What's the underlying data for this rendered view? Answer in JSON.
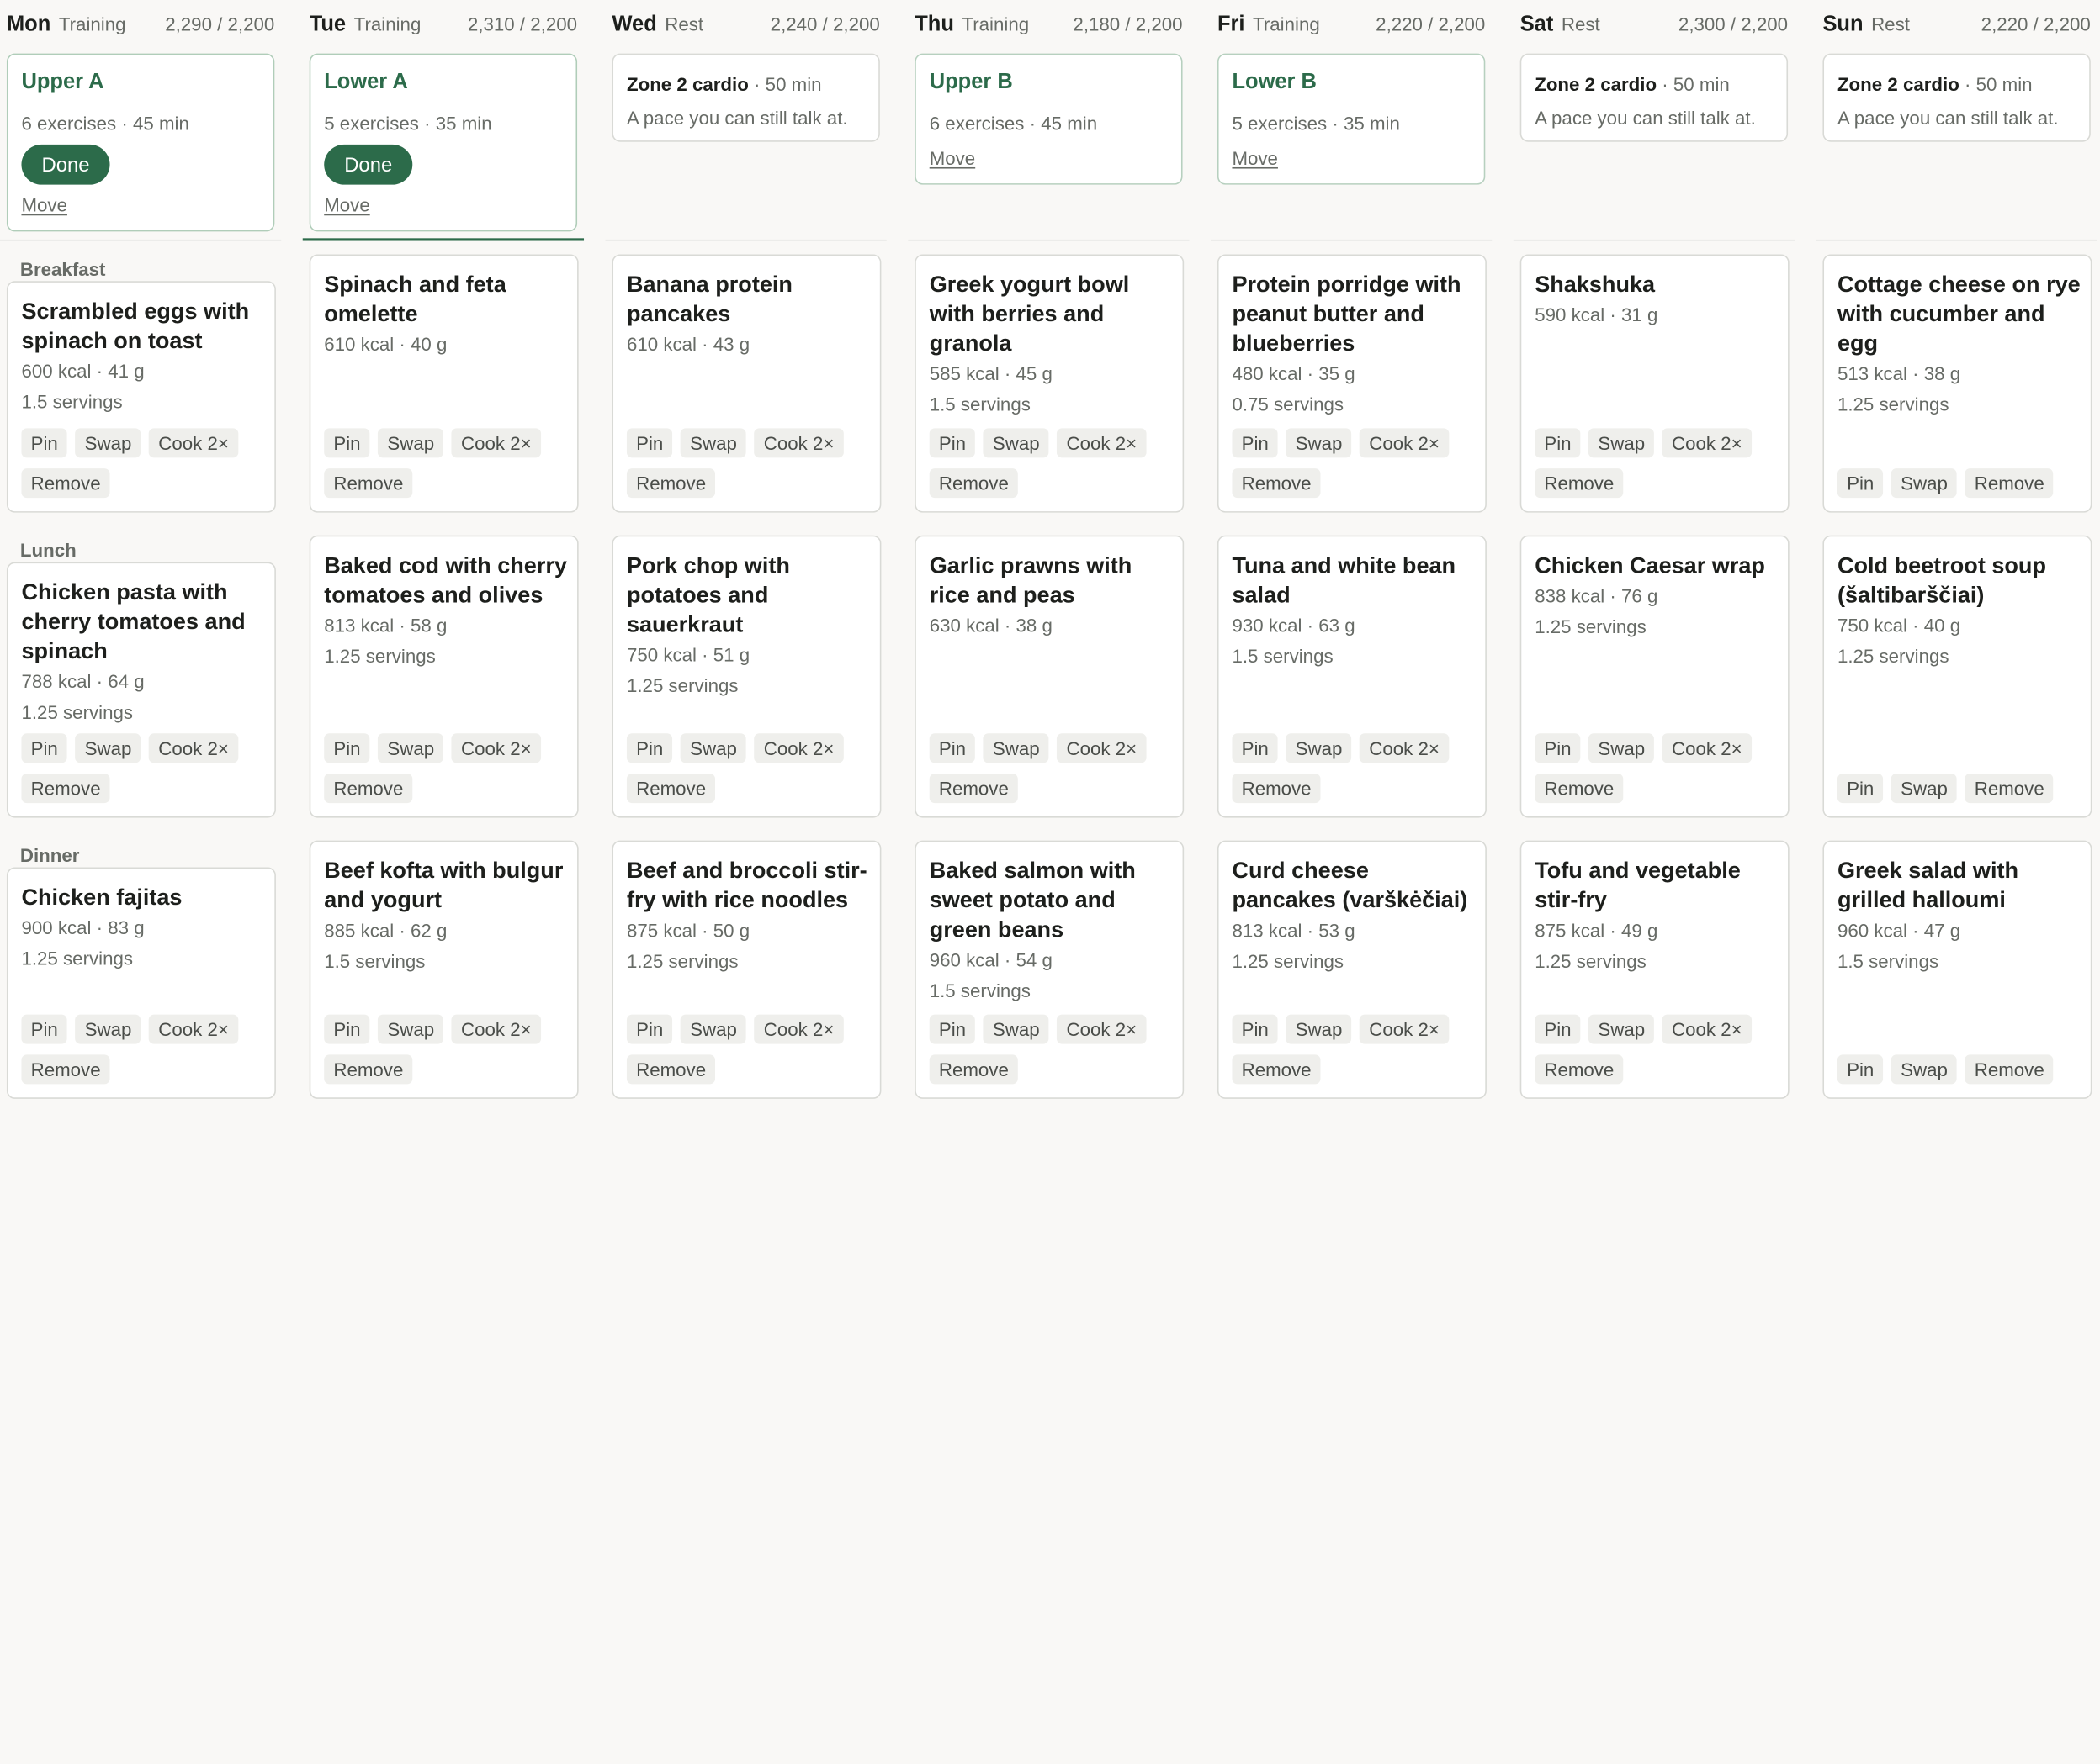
{
  "labels": {
    "done": "Done",
    "move": "Move",
    "breakfast": "Breakfast",
    "lunch": "Lunch",
    "dinner": "Dinner",
    "pin": "Pin",
    "swap": "Swap",
    "cook2x": "Cook 2×",
    "remove": "Remove"
  },
  "colors": {
    "accent": "#2c6b4a",
    "chip_bg": "#efefec",
    "muted": "#676b66"
  },
  "days": [
    {
      "name": "Mon",
      "type": "Training",
      "kcal": "2,290 / 2,200",
      "workout": {
        "kind": "training",
        "title": "Upper A",
        "meta": "6 exercises · 45 min",
        "done": true
      },
      "meals": [
        {
          "name": "Scrambled eggs with spinach on toast",
          "kcal": "600 kcal · 41 g",
          "servings": "1.5 servings"
        },
        {
          "name": "Chicken pasta with cherry tomatoes and spinach",
          "kcal": "788 kcal · 64 g",
          "servings": "1.25 servings"
        },
        {
          "name": "Chicken fajitas",
          "kcal": "900 kcal · 83 g",
          "servings": "1.25 servings"
        }
      ]
    },
    {
      "name": "Tue",
      "type": "Training",
      "kcal": "2,310 / 2,200",
      "workout": {
        "kind": "training",
        "title": "Lower A",
        "meta": "5 exercises · 35 min",
        "done": true
      },
      "meals": [
        {
          "name": "Spinach and feta omelette",
          "kcal": "610 kcal · 40 g",
          "servings": ""
        },
        {
          "name": "Baked cod with cherry tomatoes and olives",
          "kcal": "813 kcal · 58 g",
          "servings": "1.25 servings"
        },
        {
          "name": "Beef kofta with bulgur and yogurt",
          "kcal": "885 kcal · 62 g",
          "servings": "1.5 servings"
        }
      ]
    },
    {
      "name": "Wed",
      "type": "Rest",
      "kcal": "2,240 / 2,200",
      "workout": {
        "kind": "cardio",
        "title": "Zone 2 cardio",
        "minutes": " · 50 min",
        "desc": "A pace you can still talk at."
      },
      "meals": [
        {
          "name": "Banana protein pancakes",
          "kcal": "610 kcal · 43 g",
          "servings": ""
        },
        {
          "name": "Pork chop with potatoes and sauerkraut",
          "kcal": "750 kcal · 51 g",
          "servings": "1.25 servings"
        },
        {
          "name": "Beef and broccoli stir-fry with rice noodles",
          "kcal": "875 kcal · 50 g",
          "servings": "1.25 servings"
        }
      ]
    },
    {
      "name": "Thu",
      "type": "Training",
      "kcal": "2,180 / 2,200",
      "workout": {
        "kind": "training",
        "title": "Upper B",
        "meta": "6 exercises · 45 min",
        "done": false
      },
      "meals": [
        {
          "name": "Greek yogurt bowl with berries and granola",
          "kcal": "585 kcal · 45 g",
          "servings": "1.5 servings"
        },
        {
          "name": "Garlic prawns with rice and peas",
          "kcal": "630 kcal · 38 g",
          "servings": ""
        },
        {
          "name": "Baked salmon with sweet potato and green beans",
          "kcal": "960 kcal · 54 g",
          "servings": "1.5 servings"
        }
      ]
    },
    {
      "name": "Fri",
      "type": "Training",
      "kcal": "2,220 / 2,200",
      "workout": {
        "kind": "training",
        "title": "Lower B",
        "meta": "5 exercises · 35 min",
        "done": false
      },
      "meals": [
        {
          "name": "Protein porridge with peanut butter and blueberries",
          "kcal": "480 kcal · 35 g",
          "servings": "0.75 servings"
        },
        {
          "name": "Tuna and white bean salad",
          "kcal": "930 kcal · 63 g",
          "servings": "1.5 servings"
        },
        {
          "name": "Curd cheese pancakes (varškėčiai)",
          "kcal": "813 kcal · 53 g",
          "servings": "1.25 servings"
        }
      ]
    },
    {
      "name": "Sat",
      "type": "Rest",
      "kcal": "2,300 / 2,200",
      "workout": {
        "kind": "cardio",
        "title": "Zone 2 cardio",
        "minutes": " · 50 min",
        "desc": "A pace you can still talk at."
      },
      "meals": [
        {
          "name": "Shakshuka",
          "kcal": "590 kcal · 31 g",
          "servings": ""
        },
        {
          "name": "Chicken Caesar wrap",
          "kcal": "838 kcal · 76 g",
          "servings": "1.25 servings"
        },
        {
          "name": "Tofu and vegetable stir-fry",
          "kcal": "875 kcal · 49 g",
          "servings": "1.25 servings"
        }
      ]
    },
    {
      "name": "Sun",
      "type": "Rest",
      "kcal": "2,220 / 2,200",
      "workout": {
        "kind": "cardio",
        "title": "Zone 2 cardio",
        "minutes": " · 50 min",
        "desc": "A pace you can still talk at."
      },
      "meals": [
        {
          "name": "Cottage cheese on rye with cucumber and egg",
          "kcal": "513 kcal · 38 g",
          "servings": "1.25 servings",
          "no_cook": true
        },
        {
          "name": "Cold beetroot soup (šaltibarščiai)",
          "kcal": "750 kcal · 40 g",
          "servings": "1.25 servings",
          "no_cook": true
        },
        {
          "name": "Greek salad with grilled halloumi",
          "kcal": "960 kcal · 47 g",
          "servings": "1.5 servings",
          "no_cook": true
        }
      ]
    }
  ]
}
